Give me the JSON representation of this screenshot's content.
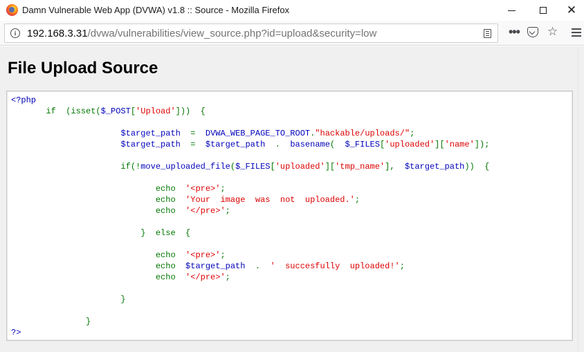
{
  "window": {
    "title": "Damn Vulnerable Web App (DVWA) v1.8 :: Source - Mozilla Firefox"
  },
  "navbar": {
    "url_host": "192.168.3.31",
    "url_path": "/dvwa/vulnerabilities/view_source.php?id=upload&security=low"
  },
  "page": {
    "title": "File Upload Source"
  },
  "icons": {
    "browser": "firefox-logo-icon",
    "site_info": "info-icon",
    "reader": "reader-view-icon",
    "page_actions": "more-dots-icon",
    "pocket": "pocket-icon",
    "bookmark": "star-icon",
    "menu": "hamburger-menu-icon"
  },
  "colors": {
    "keyword": "#007700",
    "variable": "#0000bb",
    "string": "#dd0000",
    "content_bg": "#f0f0f0"
  },
  "code": {
    "lines": [
      [
        {
          "t": "&lt;?php",
          "c": "var"
        }
      ],
      [
        {
          "t": "       if  (isset(",
          "c": "kw"
        },
        {
          "t": "$_POST",
          "c": "var"
        },
        {
          "t": "[",
          "c": "kw"
        },
        {
          "t": "'Upload'",
          "c": "str"
        },
        {
          "t": "]))  {",
          "c": "kw"
        }
      ],
      [],
      [
        {
          "t": "                      ",
          "c": "kw"
        },
        {
          "t": "$target_path ",
          "c": "var"
        },
        {
          "t": " =  ",
          "c": "kw"
        },
        {
          "t": "DVWA_WEB_PAGE_TO_ROOT",
          "c": "var"
        },
        {
          "t": ".",
          "c": "kw"
        },
        {
          "t": "\"hackable/uploads/\"",
          "c": "str"
        },
        {
          "t": ";",
          "c": "kw"
        }
      ],
      [
        {
          "t": "                      ",
          "c": "kw"
        },
        {
          "t": "$target_path ",
          "c": "var"
        },
        {
          "t": " =  ",
          "c": "kw"
        },
        {
          "t": "$target_path ",
          "c": "var"
        },
        {
          "t": " .  ",
          "c": "kw"
        },
        {
          "t": "basename",
          "c": "var"
        },
        {
          "t": "(  ",
          "c": "kw"
        },
        {
          "t": "$_FILES",
          "c": "var"
        },
        {
          "t": "[",
          "c": "kw"
        },
        {
          "t": "'uploaded'",
          "c": "str"
        },
        {
          "t": "][",
          "c": "kw"
        },
        {
          "t": "'name'",
          "c": "str"
        },
        {
          "t": "]);",
          "c": "kw"
        }
      ],
      [],
      [
        {
          "t": "                      if(!",
          "c": "kw"
        },
        {
          "t": "move_uploaded_file",
          "c": "var"
        },
        {
          "t": "(",
          "c": "kw"
        },
        {
          "t": "$_FILES",
          "c": "var"
        },
        {
          "t": "[",
          "c": "kw"
        },
        {
          "t": "'uploaded'",
          "c": "str"
        },
        {
          "t": "][",
          "c": "kw"
        },
        {
          "t": "'tmp_name'",
          "c": "str"
        },
        {
          "t": "],  ",
          "c": "kw"
        },
        {
          "t": "$target_path",
          "c": "var"
        },
        {
          "t": "))  {",
          "c": "kw"
        }
      ],
      [],
      [
        {
          "t": "                             echo  ",
          "c": "kw"
        },
        {
          "t": "'&lt;pre&gt;'",
          "c": "str"
        },
        {
          "t": ";",
          "c": "kw"
        }
      ],
      [
        {
          "t": "                             echo  ",
          "c": "kw"
        },
        {
          "t": "'Your  image  was  not  uploaded.'",
          "c": "str"
        },
        {
          "t": ";",
          "c": "kw"
        }
      ],
      [
        {
          "t": "                             echo  ",
          "c": "kw"
        },
        {
          "t": "'&lt;/pre&gt;'",
          "c": "str"
        },
        {
          "t": ";",
          "c": "kw"
        }
      ],
      [],
      [
        {
          "t": "                          }  else  {",
          "c": "kw"
        }
      ],
      [],
      [
        {
          "t": "                             echo  ",
          "c": "kw"
        },
        {
          "t": "'&lt;pre&gt;'",
          "c": "str"
        },
        {
          "t": ";",
          "c": "kw"
        }
      ],
      [
        {
          "t": "                             echo  ",
          "c": "kw"
        },
        {
          "t": "$target_path ",
          "c": "var"
        },
        {
          "t": " .  ",
          "c": "kw"
        },
        {
          "t": "'  succesfully  uploaded!'",
          "c": "str"
        },
        {
          "t": ";",
          "c": "kw"
        }
      ],
      [
        {
          "t": "                             echo  ",
          "c": "kw"
        },
        {
          "t": "'&lt;/pre&gt;'",
          "c": "str"
        },
        {
          "t": ";",
          "c": "kw"
        }
      ],
      [],
      [
        {
          "t": "                      }",
          "c": "kw"
        }
      ],
      [],
      [
        {
          "t": "               }",
          "c": "kw"
        }
      ],
      [
        {
          "t": "?&gt;",
          "c": "var"
        }
      ]
    ]
  }
}
